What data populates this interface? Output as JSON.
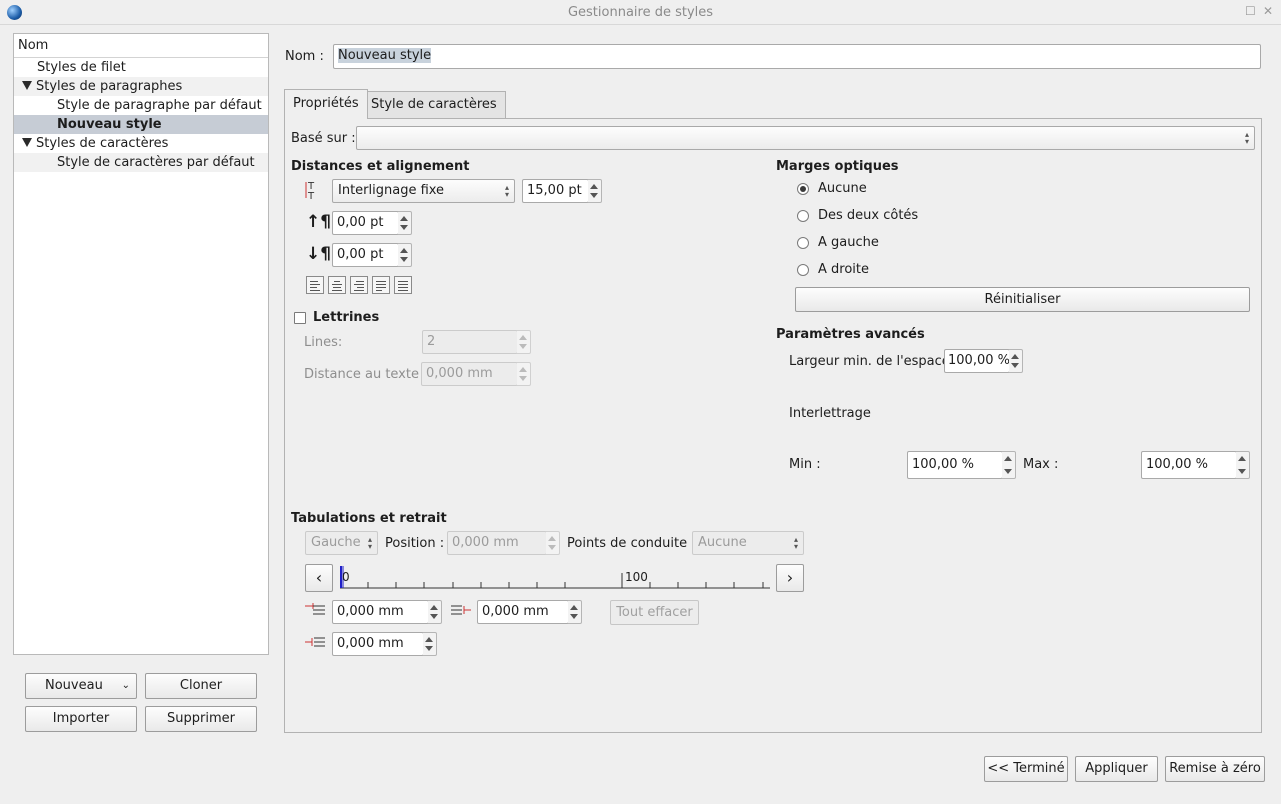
{
  "window": {
    "title": "Gestionnaire de styles"
  },
  "tree": {
    "header": "Nom",
    "items": [
      {
        "label": "Styles de filet"
      },
      {
        "label": "Styles de paragraphes"
      },
      {
        "label": "Style de paragraphe par défaut"
      },
      {
        "label": "Nouveau style"
      },
      {
        "label": "Styles de caractères"
      },
      {
        "label": "Style de caractères par défaut"
      }
    ]
  },
  "left_buttons": {
    "new": "Nouveau",
    "clone": "Cloner",
    "import": "Importer",
    "delete": "Supprimer"
  },
  "name_field": {
    "label": "Nom :",
    "value": "Nouveau style"
  },
  "tabs": [
    {
      "label": "Propriétés"
    },
    {
      "label": "Style de caractères"
    }
  ],
  "based_on": {
    "label": "Basé sur :",
    "value": ""
  },
  "distances": {
    "heading": "Distances et alignement",
    "line_spacing_mode": "Interlignage fixe",
    "line_spacing_value": "15,00 pt",
    "space_above": "0,00 pt",
    "space_below": "0,00 pt"
  },
  "dropcaps": {
    "label": "Lettrines",
    "lines_label": "Lines:",
    "lines_value": "2",
    "distance_label": "Distance au texte :",
    "distance_value": "0,000 mm"
  },
  "optical": {
    "heading": "Marges optiques",
    "options": [
      "Aucune",
      "Des deux côtés",
      "A gauche",
      "A droite"
    ],
    "selected": "Aucune",
    "reset": "Réinitialiser"
  },
  "advanced": {
    "heading": "Paramètres avancés",
    "min_space_label": "Largeur min. de l'espace:",
    "min_space_value": "100,00 %",
    "glyph_label": "Interlettrage",
    "min_label": "Min :",
    "min_value": "100,00 %",
    "max_label": "Max :",
    "max_value": "100,00 %"
  },
  "tabs_indent": {
    "heading": "Tabulations et retrait",
    "tab_type": "Gauche",
    "position_label": "Position :",
    "position_value": "0,000 mm",
    "leader_label": "Points de conduite :",
    "leader_value": "Aucune",
    "ruler_start": "0",
    "ruler_mid": "100",
    "first_line": "0,000 mm",
    "right_indent": "0,000 mm",
    "clear_all": "Tout effacer",
    "left_indent": "0,000 mm"
  },
  "bottom_buttons": {
    "done": "<< Terminé",
    "apply": "Appliquer",
    "reset": "Remise à zéro"
  }
}
